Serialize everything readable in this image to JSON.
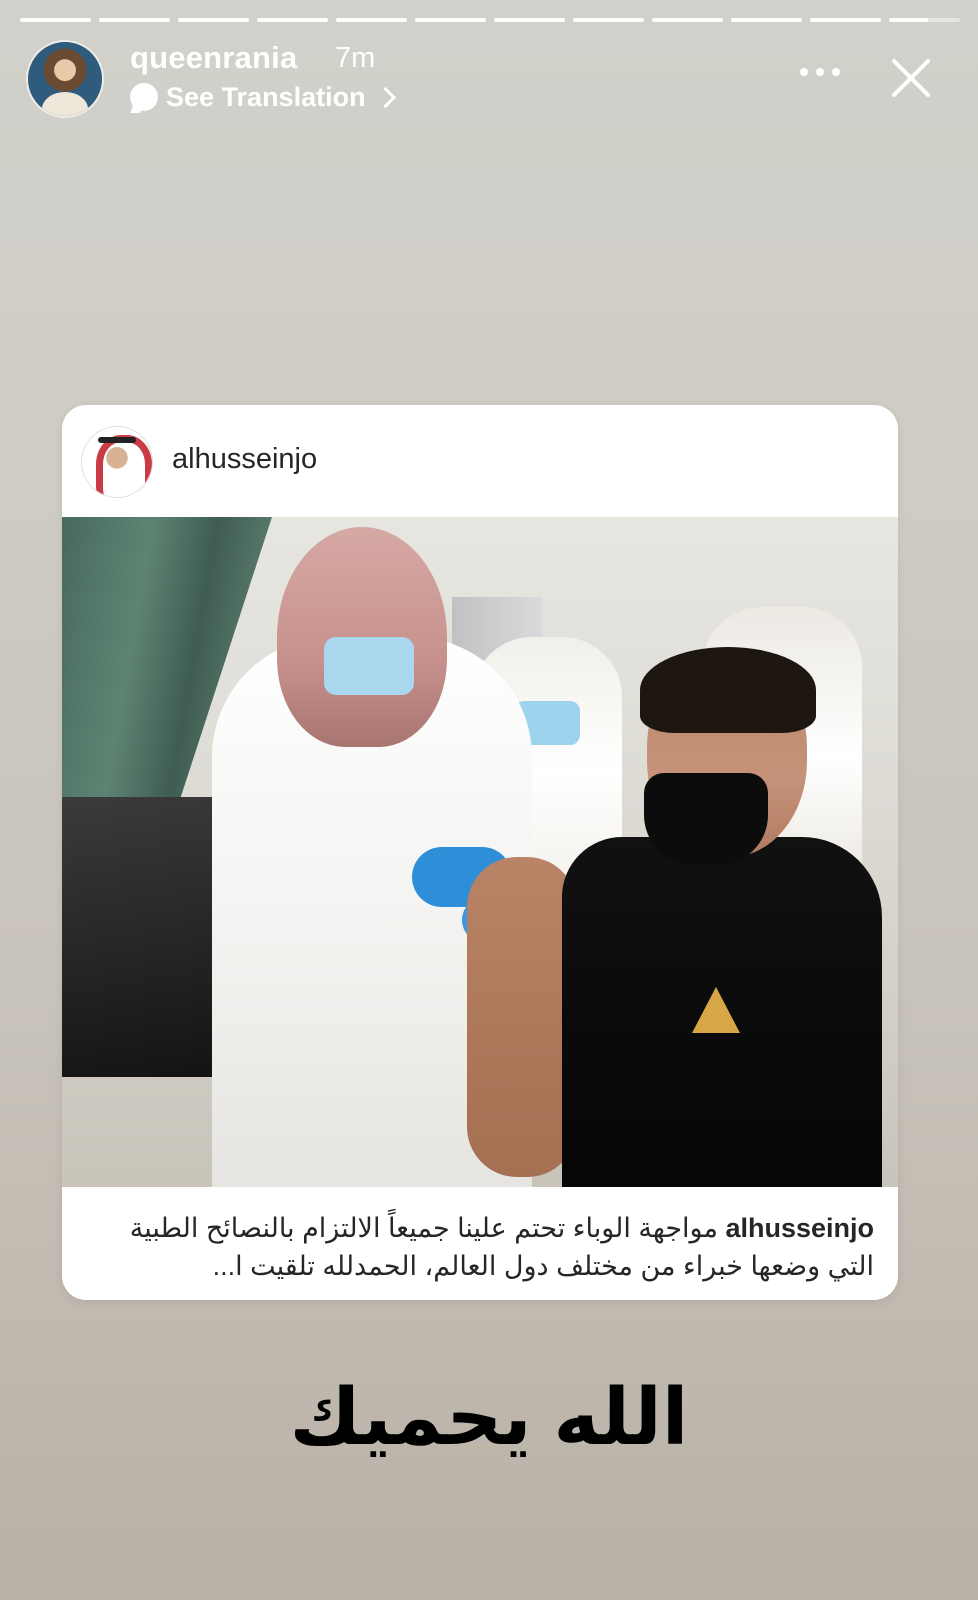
{
  "story": {
    "segments_total": 12,
    "active_segment": 12,
    "username": "queenrania",
    "time_ago": "7m",
    "translation_label": "See Translation",
    "overlay_text": "الله يحميك"
  },
  "shared_post": {
    "username": "alhusseinjo",
    "caption_user": "alhusseinjo",
    "caption_text": "مواجهة الوباء تحتم علينا جميعاً الالتزام بالنصائح الطبية التي وضعها خبراء من مختلف دول العالم، الحمدلله تلقيت ا..."
  },
  "icons": {
    "more": "more-options-icon",
    "close": "close-icon",
    "translation": "speech-bubble-icon",
    "chevron": "chevron-right-icon"
  }
}
